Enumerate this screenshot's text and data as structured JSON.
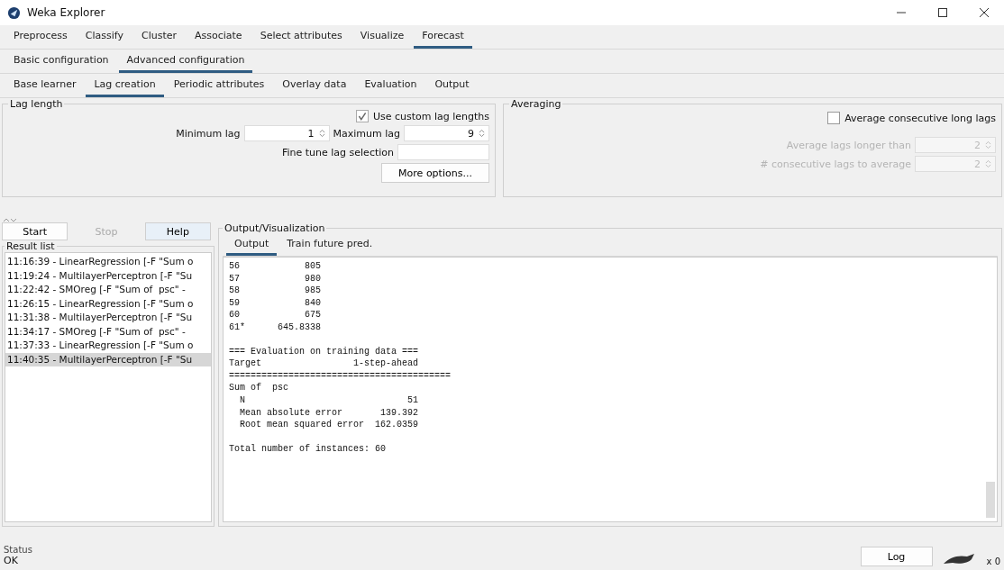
{
  "window": {
    "title": "Weka Explorer"
  },
  "main_tabs": [
    {
      "label": "Preprocess",
      "selected": false
    },
    {
      "label": "Classify",
      "selected": false
    },
    {
      "label": "Cluster",
      "selected": false
    },
    {
      "label": "Associate",
      "selected": false
    },
    {
      "label": "Select attributes",
      "selected": false
    },
    {
      "label": "Visualize",
      "selected": false
    },
    {
      "label": "Forecast",
      "selected": true
    }
  ],
  "config_tabs": [
    {
      "label": "Basic configuration",
      "selected": false
    },
    {
      "label": "Advanced configuration",
      "selected": true
    }
  ],
  "sub_tabs": [
    {
      "label": "Base learner",
      "selected": false
    },
    {
      "label": "Lag creation",
      "selected": true
    },
    {
      "label": "Periodic attributes",
      "selected": false
    },
    {
      "label": "Overlay data",
      "selected": false
    },
    {
      "label": "Evaluation",
      "selected": false
    },
    {
      "label": "Output",
      "selected": false
    }
  ],
  "lag_length": {
    "title": "Lag length",
    "custom_checkbox": {
      "label": "Use custom lag lengths",
      "checked": true
    },
    "minimum_label": "Minimum lag",
    "minimum_value": "1",
    "maximum_label": "Maximum lag",
    "maximum_value": "9",
    "fine_tune_label": "Fine tune lag selection",
    "more_button": "More options..."
  },
  "averaging": {
    "title": "Averaging",
    "checkbox": {
      "label": "Average consecutive long lags",
      "checked": false
    },
    "fields": [
      {
        "label": "Average lags longer than",
        "value": "2",
        "disabled": true
      },
      {
        "label": "# consecutive lags to average",
        "value": "2",
        "disabled": true
      }
    ]
  },
  "buttons": [
    {
      "label": "Start",
      "disabled": false
    },
    {
      "label": "Stop",
      "disabled": true
    },
    {
      "label": "Help",
      "disabled": false
    }
  ],
  "result_list": {
    "title": "Result list",
    "items": [
      {
        "text": "11:16:39 - LinearRegression [-F \"Sum o",
        "selected": false
      },
      {
        "text": "11:19:24 - MultilayerPerceptron [-F \"Su",
        "selected": false
      },
      {
        "text": "11:22:42 - SMOreg [-F \"Sum of  psc\" -",
        "selected": false
      },
      {
        "text": "11:26:15 - LinearRegression [-F \"Sum o",
        "selected": false
      },
      {
        "text": "11:31:38 - MultilayerPerceptron [-F \"Su",
        "selected": false
      },
      {
        "text": "11:34:17 - SMOreg [-F \"Sum of  psc\" -",
        "selected": false
      },
      {
        "text": "11:37:33 - LinearRegression [-F \"Sum o",
        "selected": false
      },
      {
        "text": "11:40:35 - MultilayerPerceptron [-F \"Su",
        "selected": true
      }
    ]
  },
  "output": {
    "title": "Output/Visualization",
    "tabs": [
      {
        "label": "Output",
        "selected": true
      },
      {
        "label": "Train future pred.",
        "selected": false
      }
    ],
    "blocks": [
      [
        "56            805",
        "57            980",
        "58            985",
        "59            840",
        "60            675",
        "61*      645.8338"
      ],
      [
        "=== Evaluation on training data ===",
        "Target                 1-step-ahead",
        "=========================================",
        "Sum of  psc",
        "  N                              51",
        "  Mean absolute error       139.392",
        "  Root mean squared error  162.0359"
      ],
      [
        "Total number of instances: 60"
      ]
    ]
  },
  "status": {
    "title": "Status",
    "text": "OK",
    "log_button": "Log",
    "count": "x 0"
  }
}
